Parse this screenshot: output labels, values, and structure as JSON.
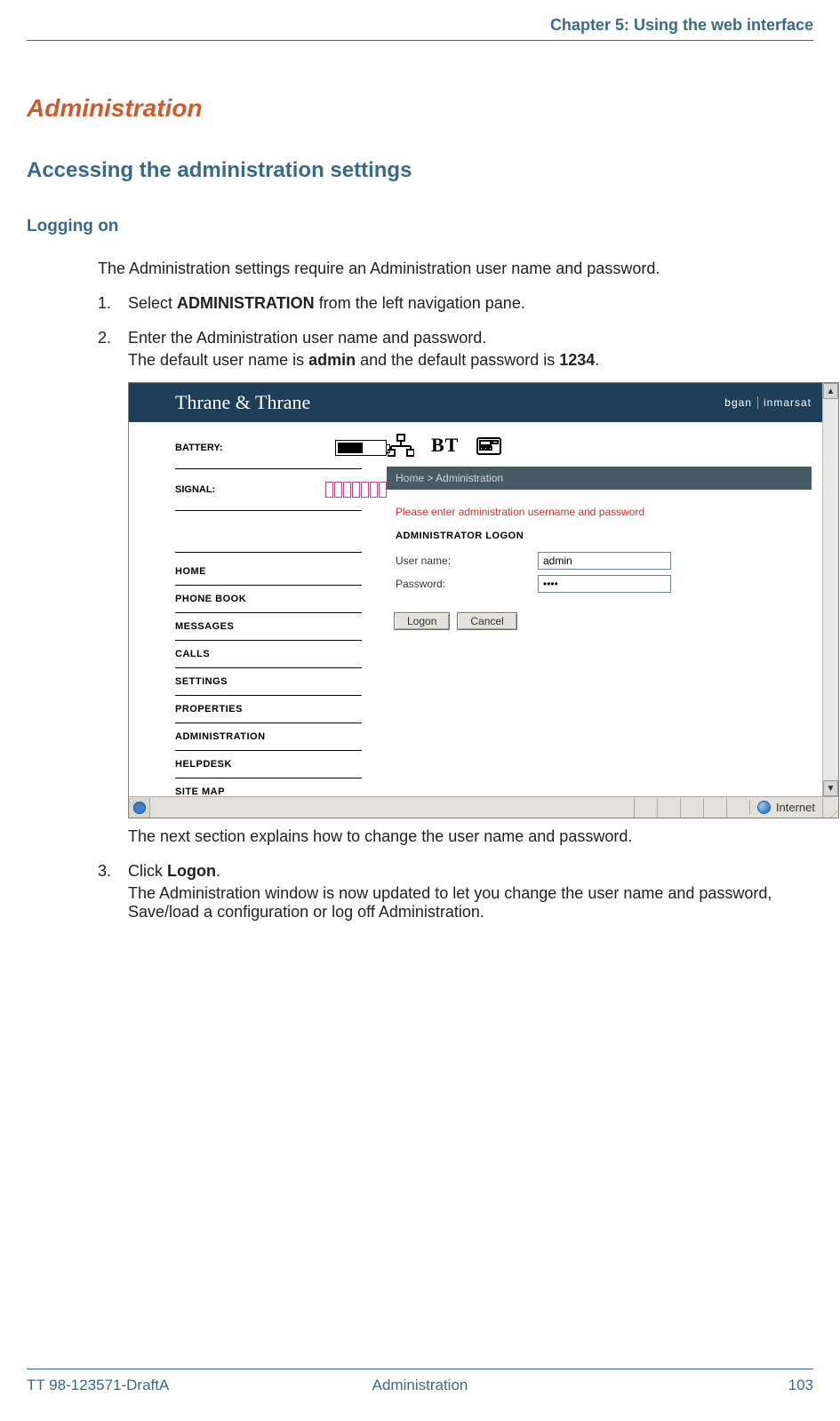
{
  "header": {
    "chapter": "Chapter 5: Using the web interface"
  },
  "headings": {
    "h1": "Administration",
    "h2": "Accessing the administration settings",
    "h3": "Logging on"
  },
  "intro": "The Administration settings require an Administration user name and password.",
  "steps": [
    {
      "num": "1.",
      "pre": "Select ",
      "bold": "ADMINISTRATION",
      "post": " from the left navigation pane."
    },
    {
      "num": "2.",
      "line1": "Enter the Administration user name and password.",
      "line2_pre": "The default user name is ",
      "line2_b1": "admin",
      "line2_mid": " and the default password is ",
      "line2_b2": "1234",
      "line2_post": "."
    },
    {
      "num": "3.",
      "pre": "Click ",
      "bold": "Logon",
      "post": ".",
      "sub": "The Administration window is now updated to let you change the user name and password, Save/load a configuration or log off Administration."
    }
  ],
  "below_shot": "The next section explains how to change the user name and password.",
  "screenshot": {
    "brand": "Thrane & Thrane",
    "brand_right_a": "bgan",
    "brand_right_b": "inmarsat",
    "sidebar": {
      "battery_label": "BATTERY:",
      "signal_label": "SIGNAL:",
      "nav": [
        "HOME",
        "PHONE BOOK",
        "MESSAGES",
        "CALLS",
        "SETTINGS",
        "PROPERTIES",
        "ADMINISTRATION",
        "HELPDESK",
        "SITE MAP"
      ]
    },
    "main": {
      "bt": "BT",
      "breadcrumb": "Home > Administration",
      "warning": "Please enter administration username and password",
      "section": "ADMINISTRATOR LOGON",
      "username_label": "User name:",
      "username_value": "admin",
      "password_label": "Password:",
      "password_value": "••••",
      "logon_btn": "Logon",
      "cancel_btn": "Cancel"
    },
    "statusbar": {
      "zone": "Internet"
    }
  },
  "footer": {
    "left": "TT 98-123571-DraftA",
    "center": "Administration",
    "right": "103"
  }
}
